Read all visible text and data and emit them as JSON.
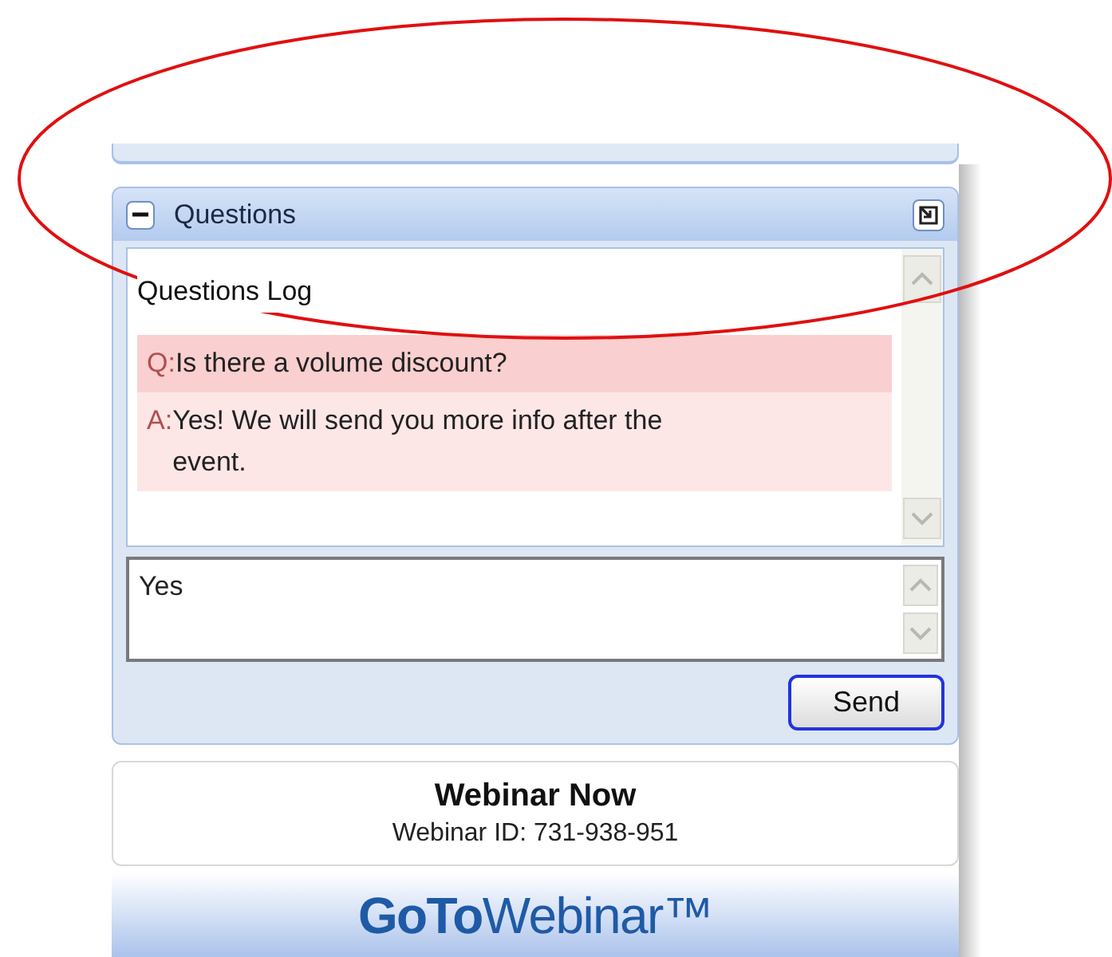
{
  "panel": {
    "title": "Questions",
    "expanded": true
  },
  "log": {
    "title": "Questions Log",
    "entries": [
      {
        "kind": "question",
        "prefix": "Q:",
        "text": "Is there a volume discount?"
      },
      {
        "kind": "answer",
        "prefix": "A:",
        "text": "Yes! We will send you more info after the event."
      }
    ]
  },
  "input": {
    "value": "Yes"
  },
  "send_button": "Send",
  "info": {
    "title": "Webinar Now",
    "id_line": "Webinar ID: 731-938-951"
  },
  "logo": "**GoTo**Webinar™",
  "annotation": {
    "kind": "ellipse"
  }
}
